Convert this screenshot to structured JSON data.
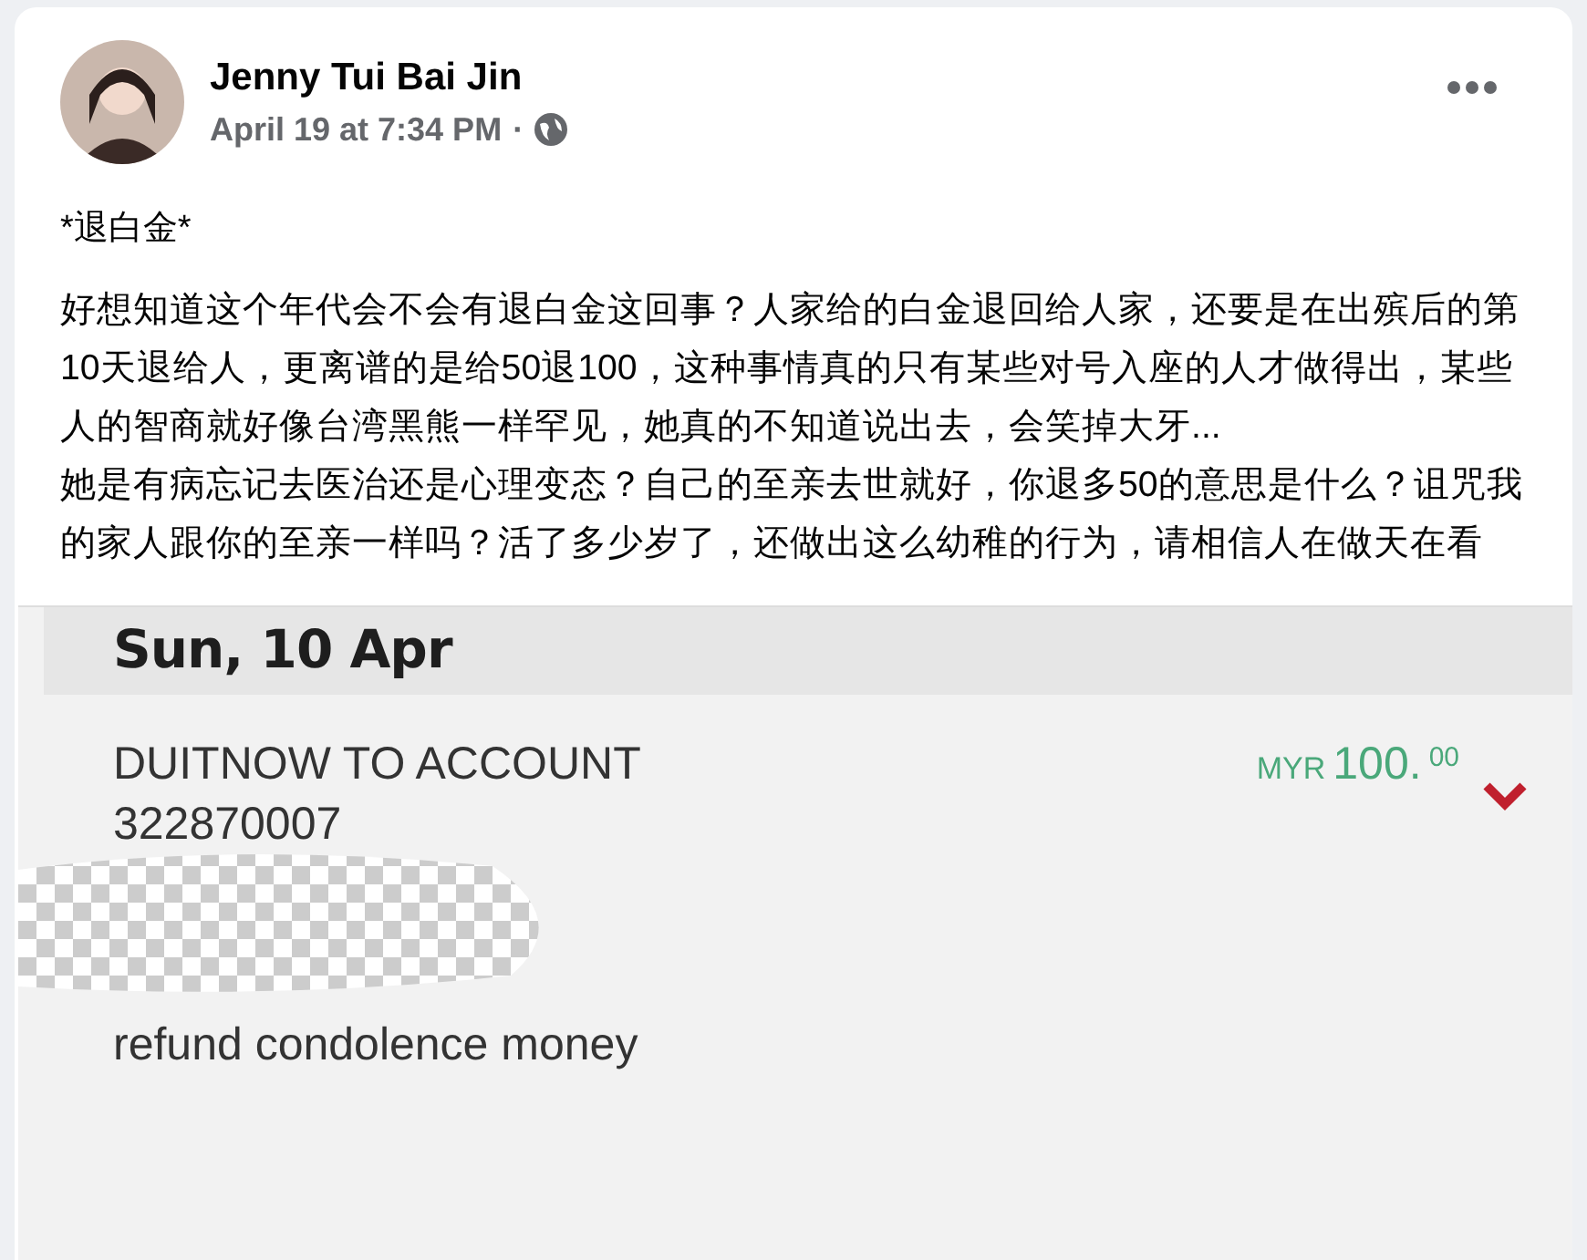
{
  "post": {
    "author": "Jenny Tui Bai Jin",
    "timestamp": "April 19 at 7:34 PM",
    "separator": "·",
    "title": "*退白金*",
    "paragraphs": [
      "好想知道这个年代会不会有退白金这回事？人家给的白金退回给人家，还要是在出殡后的第10天退给人，更离谱的是给50退100，这种事情真的只有某些对号入座的人才做得出，某些人的智商就好像台湾黑熊一样罕见，她真的不知道说出去，会笑掉大牙...",
      "她是有病忘记去医治还是心理变态？自己的至亲去世就好，你退多50的意思是什么？诅咒我的家人跟你的至亲一样吗？活了多少岁了，还做出这么幼稚的行为，请相信人在做天在看"
    ]
  },
  "transaction": {
    "date": "Sun, 10 Apr",
    "type": "DUITNOW TO ACCOUNT",
    "account": "322870007",
    "currency": "MYR",
    "amount": "100.",
    "cents": "00",
    "note": "refund condolence money"
  }
}
